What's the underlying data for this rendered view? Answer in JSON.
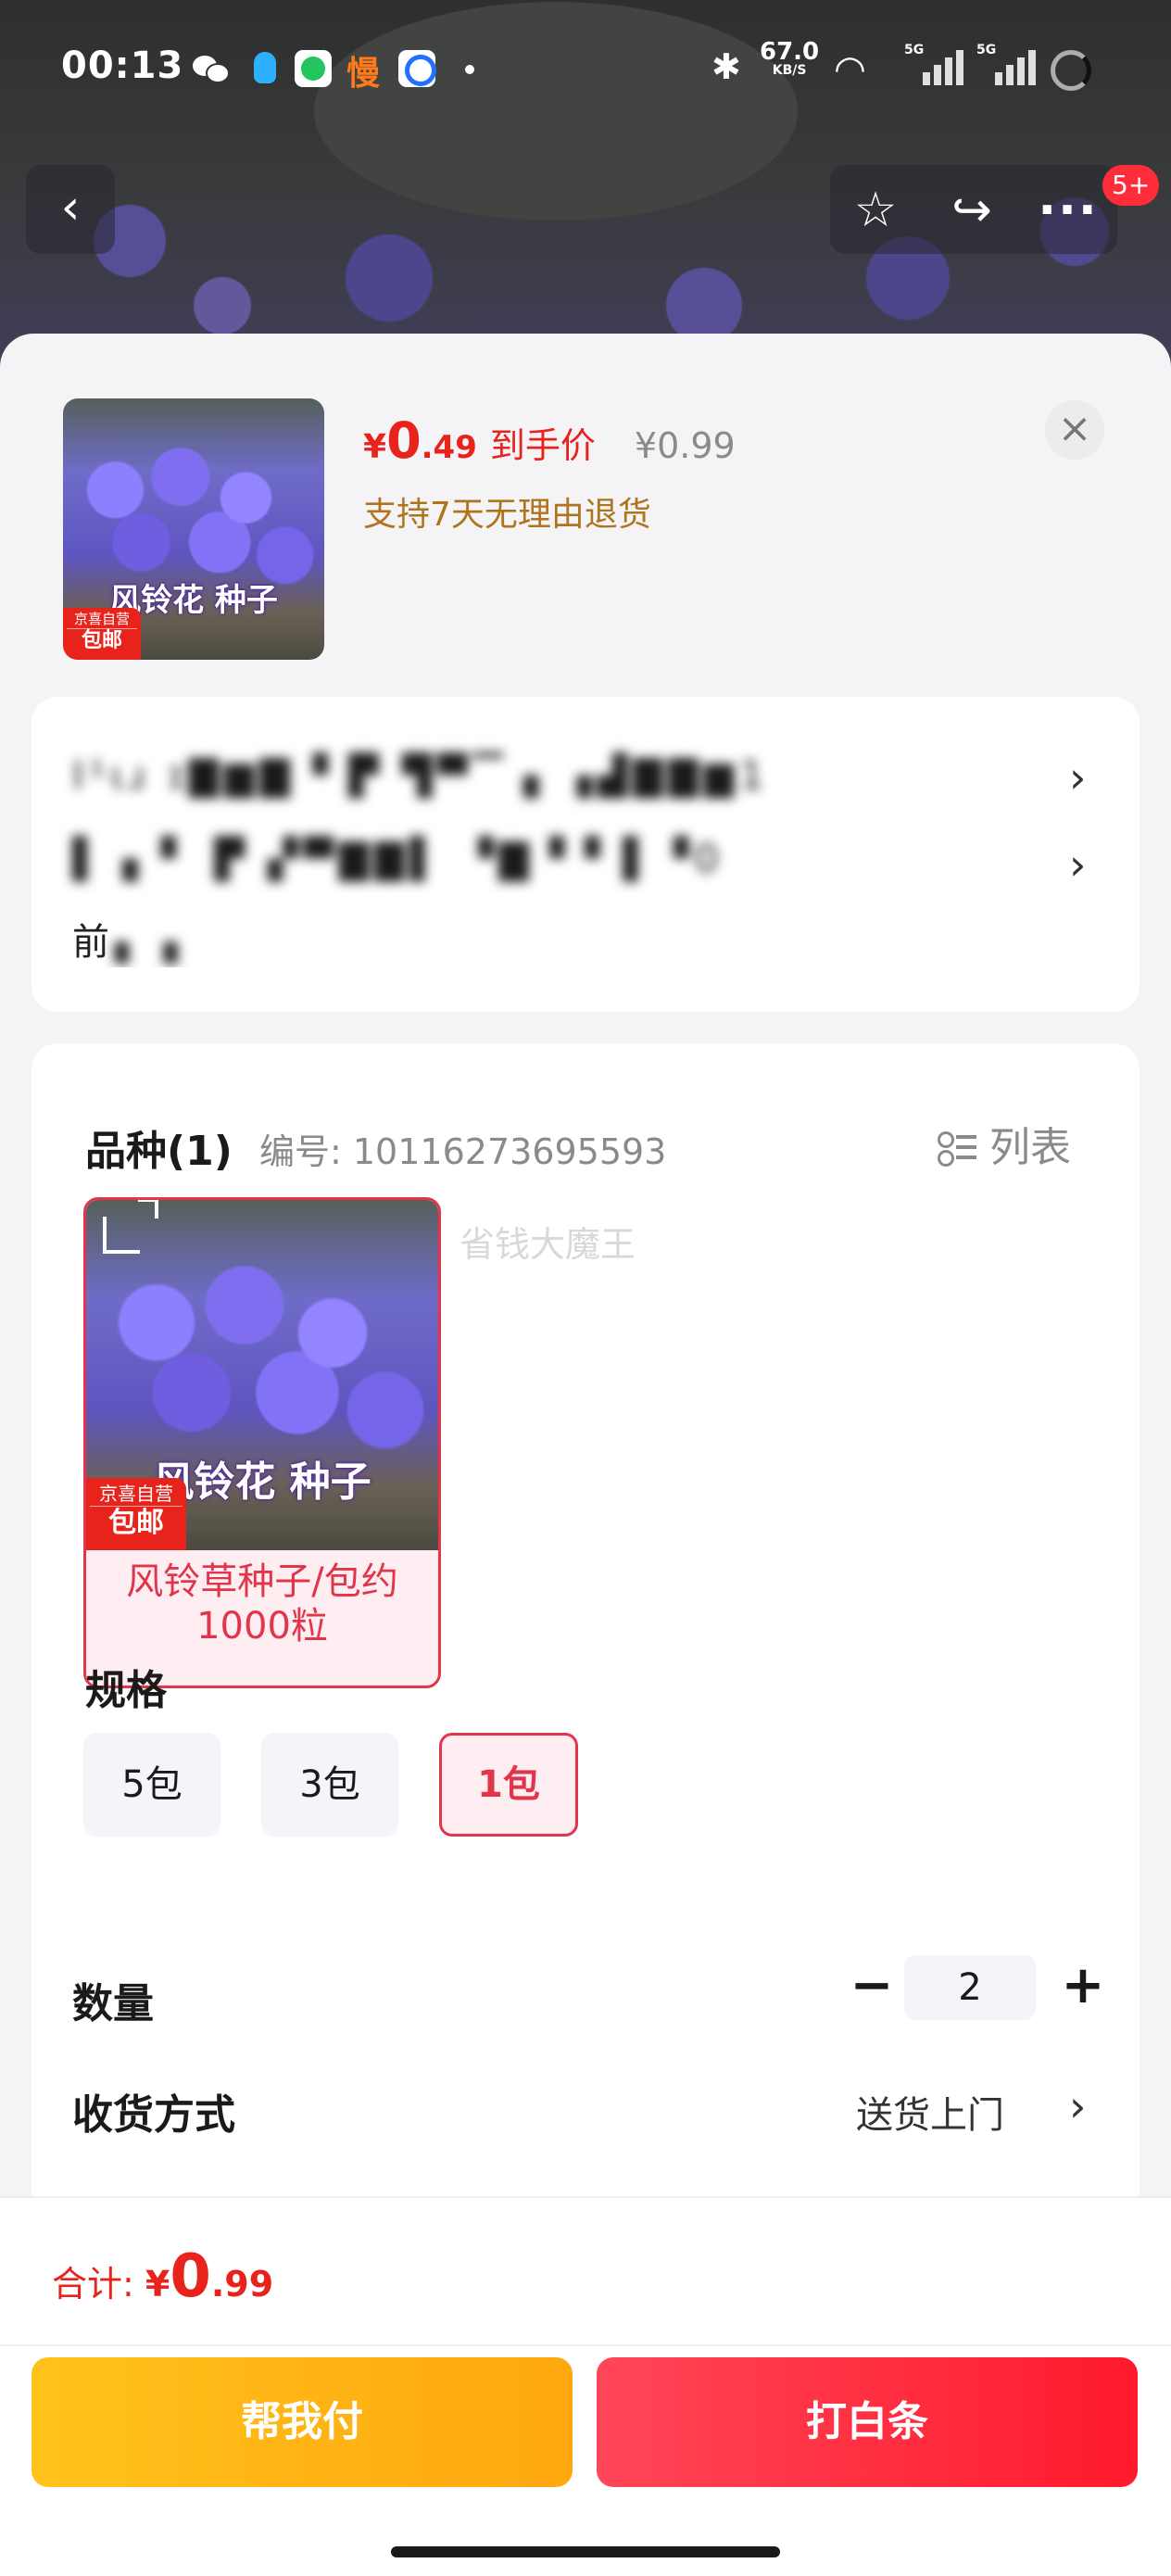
{
  "status_bar": {
    "time": "00:13",
    "net_speed": "67.0",
    "net_unit": "KB/S",
    "sig1_label": "5G",
    "sig2_label": "5G",
    "man_icon_text": "慢"
  },
  "nav": {
    "back_icon": "‹",
    "star_icon": "☆",
    "share_icon": "↪",
    "more_icon": "···",
    "badge": "5+"
  },
  "summary": {
    "photo_title": "风铃花 种子",
    "tag_top": "京喜自营",
    "tag_bottom": "包邮",
    "price_currency": "¥",
    "price_int": "0",
    "price_dec": ".49",
    "price_label": "到手价",
    "orig_price": "¥0.99",
    "return_policy": "支持7天无理由退货",
    "close_icon": "×"
  },
  "address": {
    "line1": "I¹ɩɹ  ɪ▇▆▇ ▘▛ ▜▀▔▗ ▗▟▇▇▆1",
    "line2": "▌▗ ▘ ▛ ▞▀▇▇▌ ▝▇▝▝ ▌▝0",
    "line3_prefix": "前",
    "line3_blur": "▖▗",
    "chevron": "›"
  },
  "options": {
    "variety_title": "品种(1)",
    "variety_code": "编号: 10116273695593",
    "list_toggle": "列表",
    "variety_item": {
      "photo_title": "风铃花 种子",
      "tag_top": "京喜自营",
      "tag_bottom": "包邮",
      "label": "风铃草种子/包约1000粒"
    },
    "watermark": "省钱大魔王",
    "spec_title": "规格",
    "specs": [
      "5包",
      "3包",
      "1包"
    ],
    "selected_spec": "1包",
    "quantity_title": "数量",
    "quantity": "2",
    "minus": "−",
    "plus": "+",
    "shipping_title": "收货方式",
    "shipping_value": "送货上门",
    "chevron": "›"
  },
  "bottom": {
    "total_label": "合计: ",
    "total_currency": "¥",
    "total_int": "0",
    "total_dec": ".99",
    "btn_help": "帮我付",
    "btn_iou": "打白条"
  },
  "colors": {
    "accent_red": "#e8231c",
    "selected_border": "#e0354a",
    "gold_text": "#b0741f",
    "help_btn": "#ffb315",
    "iou_btn": "#ff2b3d"
  }
}
